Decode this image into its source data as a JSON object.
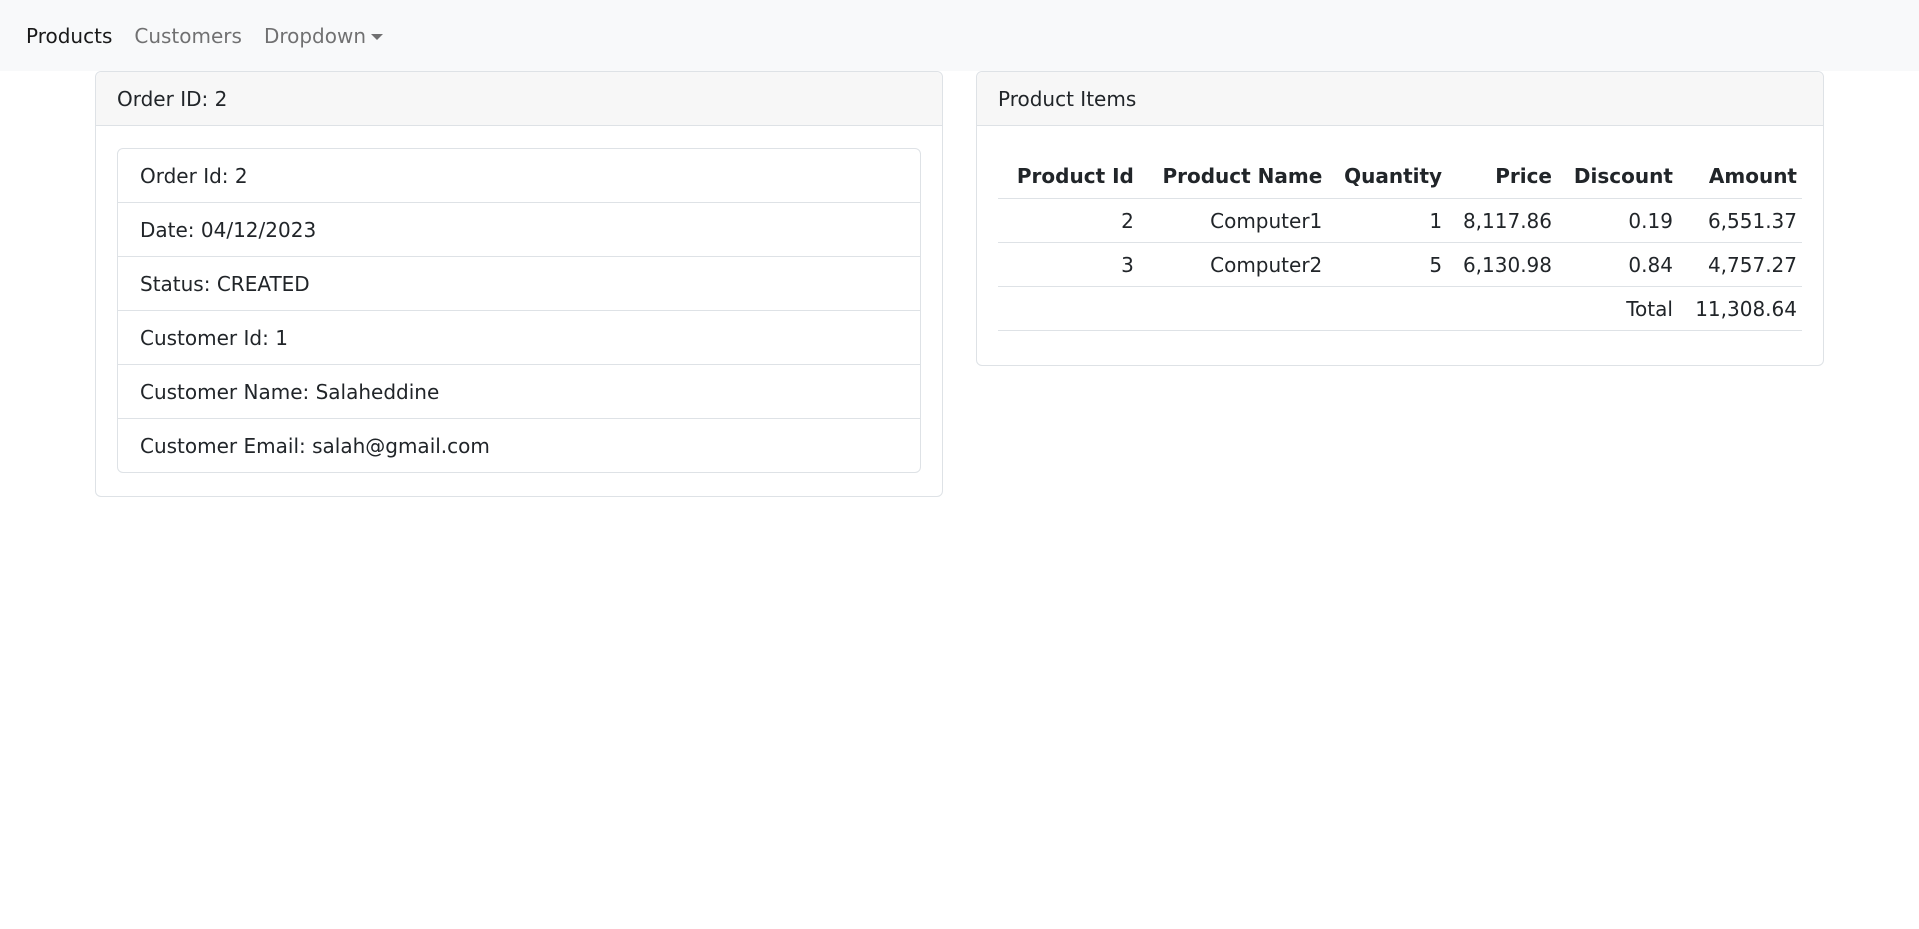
{
  "nav": {
    "items": [
      {
        "label": "Products"
      },
      {
        "label": "Customers"
      },
      {
        "label": "Dropdown"
      }
    ]
  },
  "order_card": {
    "header": "Order ID: 2",
    "details": [
      "Order Id: 2",
      "Date: 04/12/2023",
      "Status: CREATED",
      "Customer Id: 1",
      "Customer Name: Salaheddine",
      "Customer Email: salah@gmail.com"
    ]
  },
  "items_card": {
    "header": "Product Items",
    "columns": [
      "Product Id",
      "Product Name",
      "Quantity",
      "Price",
      "Discount",
      "Amount"
    ],
    "rows": [
      [
        "2",
        "Computer1",
        "1",
        "8,117.86",
        "0.19",
        "6,551.37"
      ],
      [
        "3",
        "Computer2",
        "5",
        "6,130.98",
        "0.84",
        "4,757.27"
      ]
    ],
    "total_label": "Total",
    "total_value": "11,308.64"
  }
}
